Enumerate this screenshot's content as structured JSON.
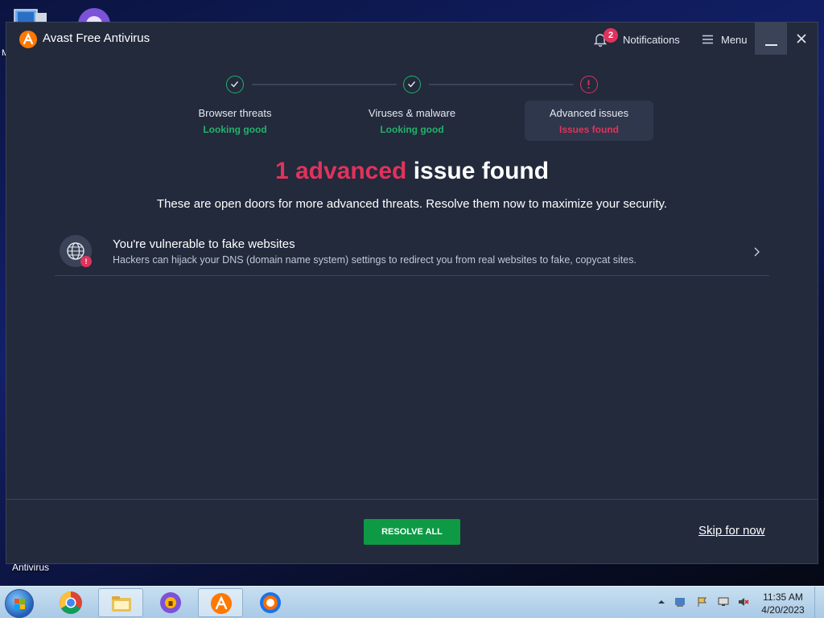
{
  "desktop": {
    "label": "Antivirus",
    "partial_char": "M"
  },
  "window": {
    "title": "Avast Free Antivirus",
    "notifications_label": "Notifications",
    "notifications_count": "2",
    "menu_label": "Menu"
  },
  "steps": [
    {
      "title": "Browser threats",
      "status": "Looking good",
      "state": "ok"
    },
    {
      "title": "Viruses & malware",
      "status": "Looking good",
      "state": "ok"
    },
    {
      "title": "Advanced issues",
      "status": "Issues found",
      "state": "bad"
    }
  ],
  "headline": {
    "count_text": "1 advanced",
    "rest_text": "issue found"
  },
  "subline": "These are open doors for more advanced threats. Resolve them now to maximize your security.",
  "issue": {
    "title": "You're vulnerable to fake websites",
    "description": "Hackers can hijack your DNS (domain name system) settings to redirect you from real websites to fake, copycat sites."
  },
  "footer": {
    "resolve_label": "RESOLVE ALL",
    "skip_label": "Skip for now"
  },
  "taskbar": {
    "time": "11:35 AM",
    "date": "4/20/2023",
    "apps": [
      "chrome-icon",
      "file-explorer-icon",
      "avast-secure-browser-icon",
      "avast-antivirus-icon",
      "avast-browser-icon"
    ]
  },
  "colors": {
    "accent_green": "#23b26b",
    "alert_red": "#e0335c",
    "window_bg": "#222a3c",
    "button_green": "#0e9a45",
    "avast_orange": "#ff7800"
  }
}
